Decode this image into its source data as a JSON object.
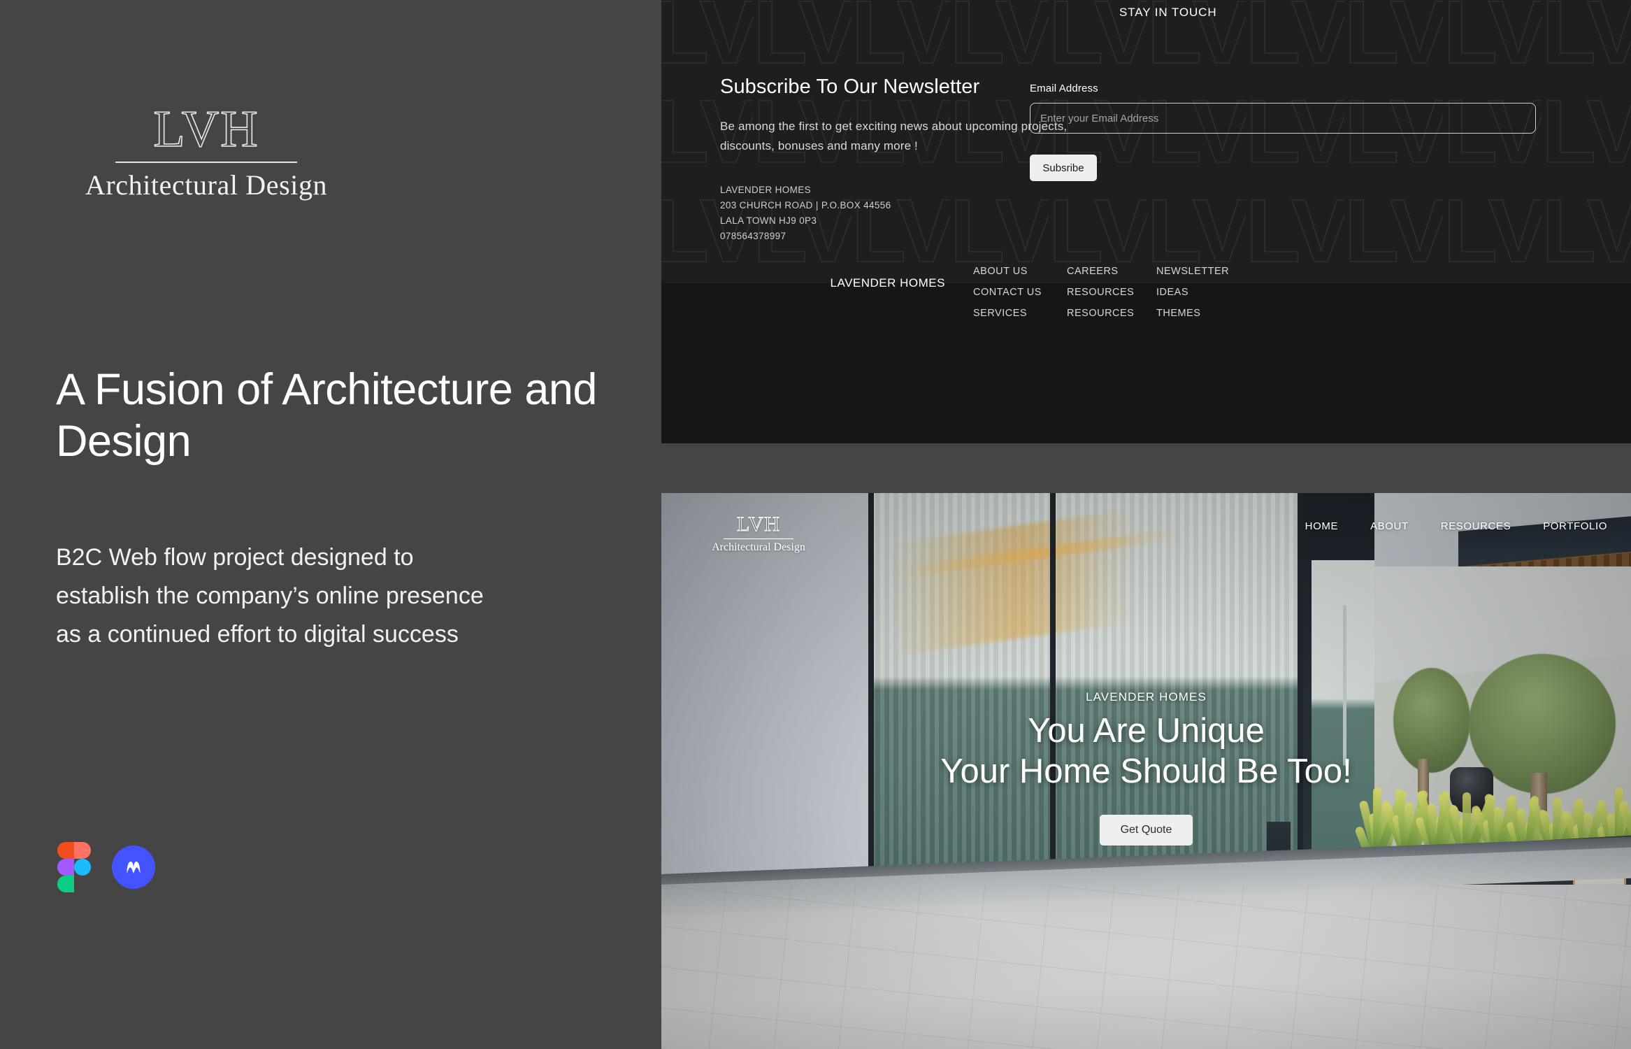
{
  "left": {
    "logo": {
      "mark": "LVH",
      "subtitle": "Architectural Design"
    },
    "headline": "A Fusion of Architecture and Design",
    "lede": "B2C Web flow project designed to establish the company’s  online presence as a continued effort to digital success",
    "tools": [
      {
        "name": "figma-logo",
        "label": "Figma"
      },
      {
        "name": "webflow-logo",
        "label": "Webflow"
      }
    ]
  },
  "newsletter": {
    "eyebrow": "STAY IN TOUCH",
    "title": "Subscribe To Our Newsletter",
    "description": "Be among the first to get exciting news about upcoming projects, discounts, bonuses and many more !",
    "address": {
      "line1": "LAVENDER HOMES",
      "line2": "203 CHURCH ROAD | P.O.BOX 44556",
      "line3": "LALA TOWN HJ9 0P3",
      "line4": "078564378997"
    },
    "form": {
      "label": "Email Address",
      "placeholder": "Enter your Email Address",
      "value": "",
      "button": "Subsribe"
    },
    "watermark_text": "LVH"
  },
  "footer": {
    "brand": "LAVENDER HOMES",
    "columns": [
      {
        "links": [
          "ABOUT US",
          "CONTACT US",
          "SERVICES"
        ]
      },
      {
        "links": [
          "CAREERS",
          "RESOURCES",
          "RESOURCES"
        ]
      },
      {
        "links": [
          "NEWSLETTER",
          "IDEAS",
          "THEMES"
        ]
      }
    ]
  },
  "hero": {
    "logo": {
      "mark": "LVH",
      "subtitle": "Architectural Design"
    },
    "nav": [
      "HOME",
      "ABOUT",
      "RESOURCES",
      "PORTFOLIO"
    ],
    "eyebrow": "LAVENDER HOMES",
    "title_line1": "You Are Unique",
    "title_line2": "Your Home Should Be Too!",
    "cta": "Get Quote"
  },
  "colors": {
    "left_panel_bg": "#454545",
    "dark_section_bg": "#161616",
    "accent_button": "#efefef",
    "figma_red": "#f24e1e",
    "figma_orange": "#ff7262",
    "figma_purple": "#a259ff",
    "figma_blue": "#1abcfe",
    "figma_green": "#0acf83",
    "webflow_blue": "#4353ff"
  }
}
